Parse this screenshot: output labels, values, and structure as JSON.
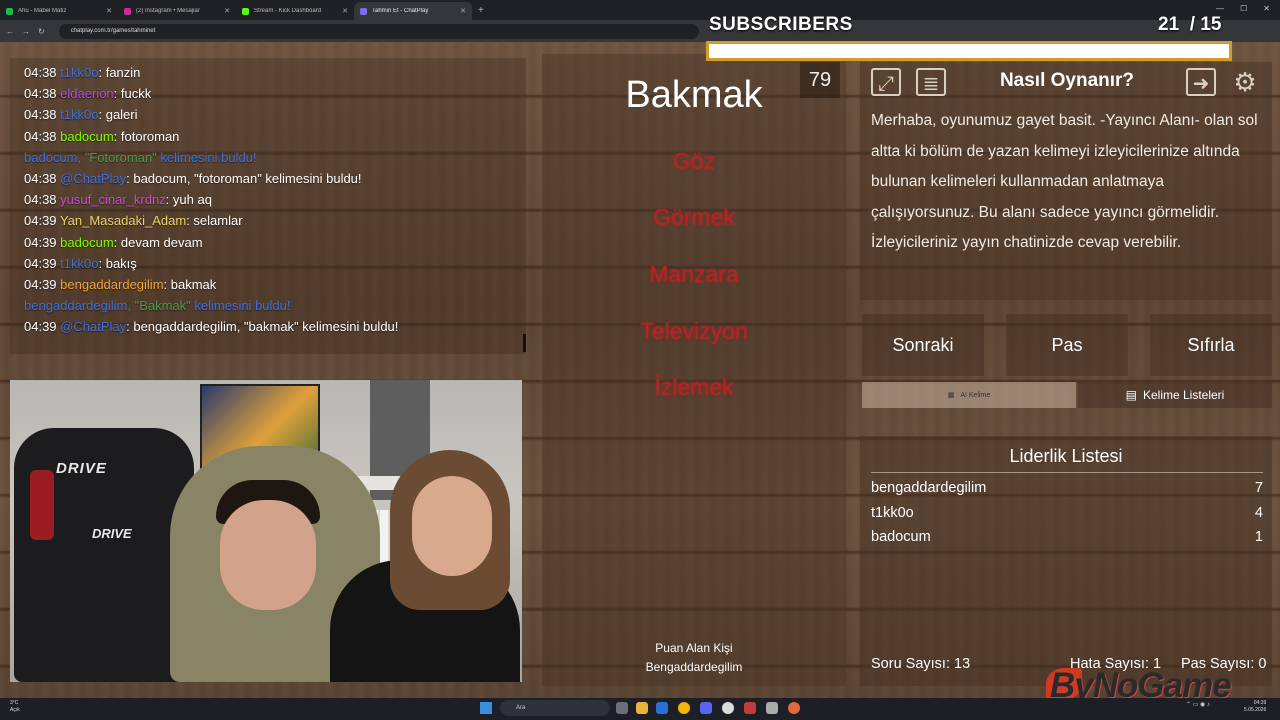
{
  "browser": {
    "tabs": [
      {
        "title": "Ahu - Mabel Matiz",
        "color": "#1db954"
      },
      {
        "title": "(2) Instagram • Mesajlar",
        "color": "#d6249f"
      },
      {
        "title": "Stream - Kick Dashboard",
        "color": "#53fc18"
      },
      {
        "title": "Tahmin Et - ChatPlay",
        "color": "#7a6cf0"
      }
    ],
    "new_tab": "+",
    "url": "chatplay.com.tr/games/tahminet"
  },
  "chat": {
    "messages": [
      {
        "time": "04:38",
        "user": "t1kk0o",
        "user_color": "#3f6fd8",
        "text": ": fanzin"
      },
      {
        "time": "04:38",
        "user": "eldaerion",
        "user_color": "#b24fd6",
        "text": ": fuckk"
      },
      {
        "time": "04:38",
        "user": "t1kk0o",
        "user_color": "#3f6fd8",
        "text": ": galeri"
      },
      {
        "time": "04:38",
        "user": "badocum",
        "user_color": "#7cfc00",
        "text": ": fotoroman"
      },
      {
        "system": true,
        "prefix": "badocum, ",
        "highlight": "\"Fotoroman\"",
        "suffix": " kelimesini buldu!"
      },
      {
        "time": "04:38",
        "user": "@ChatPlay",
        "user_color": "#3f6fd8",
        "text": ": badocum, \"fotoroman\" kelimesini buldu!"
      },
      {
        "time": "04:38",
        "user": "yusuf_cinar_krdnz",
        "user_color": "#c94bd0",
        "text": ": yuh aq"
      },
      {
        "time": "04:39",
        "user": "Yan_Masadaki_Adam",
        "user_color": "#e8d36a",
        "text": ": selamlar"
      },
      {
        "time": "04:39",
        "user": "badocum",
        "user_color": "#7cfc00",
        "text": ": devam devam"
      },
      {
        "time": "04:39",
        "user": "t1kk0o",
        "user_color": "#3f6fd8",
        "text": ": bakış"
      },
      {
        "time": "04:39",
        "user": "bengaddardegilim",
        "user_color": "#f2a33a",
        "text": ": bakmak"
      },
      {
        "system": true,
        "prefix": "bengaddardegilim, ",
        "highlight": "\"Bakmak\"",
        "suffix": " kelimesini buldu!"
      },
      {
        "time": "04:39",
        "user": "@ChatPlay",
        "user_color": "#3f6fd8",
        "text": ": bengaddardegilim, \"bakmak\" kelimesini buldu!"
      }
    ]
  },
  "webcam": {
    "chair_brand": "DRIVE",
    "chair_brand_2": "DRIVE"
  },
  "game": {
    "counter": "79",
    "word": "Bakmak",
    "taboo_words": [
      "Göz",
      "Görmek",
      "Manzara",
      "Televizyon",
      "İzlemek"
    ],
    "scorer_label": "Puan Alan Kişi",
    "scorer_name": "Bengaddardegilim"
  },
  "howto": {
    "title": "Nasıl Oynanır?",
    "text": "Merhaba, oyunumuz gayet basit. -Yayıncı Alanı- olan sol altta ki bölüm de yazan kelimeyi izleyicilerinize altında bulunan kelimeleri kullanmadan anlatmaya çalışıyorsunuz. Bu alanı sadece yayıncı görmelidir. İzleyicileriniz yayın chatinizde cevap verebilir."
  },
  "controls": {
    "next": "Sonraki",
    "pass": "Pas",
    "reset": "Sıfırla",
    "ai_word": "AI Kelime",
    "word_lists": "Kelime Listeleri"
  },
  "leaderboard": {
    "title": "Liderlik Listesi",
    "rows": [
      {
        "name": "bengaddardegilim",
        "score": "7"
      },
      {
        "name": "t1kk0o",
        "score": "4"
      },
      {
        "name": "badocum",
        "score": "1"
      }
    ]
  },
  "stats": {
    "questions": "Soru Sayısı: 13",
    "errors": "Hata Sayısı: 1",
    "passes": "Pas Sayısı: 0"
  },
  "overlay": {
    "subs_label": "SUBSCRIBERS",
    "subs_current": "21",
    "subs_goal": "/ 15",
    "subs_progress": 1.0,
    "brand": "ByNoGame"
  },
  "taskbar": {
    "weather_temp": "3°C",
    "weather_desc": "Açık",
    "search": "Ara",
    "time": "04:39",
    "date": "5.05.2026"
  }
}
